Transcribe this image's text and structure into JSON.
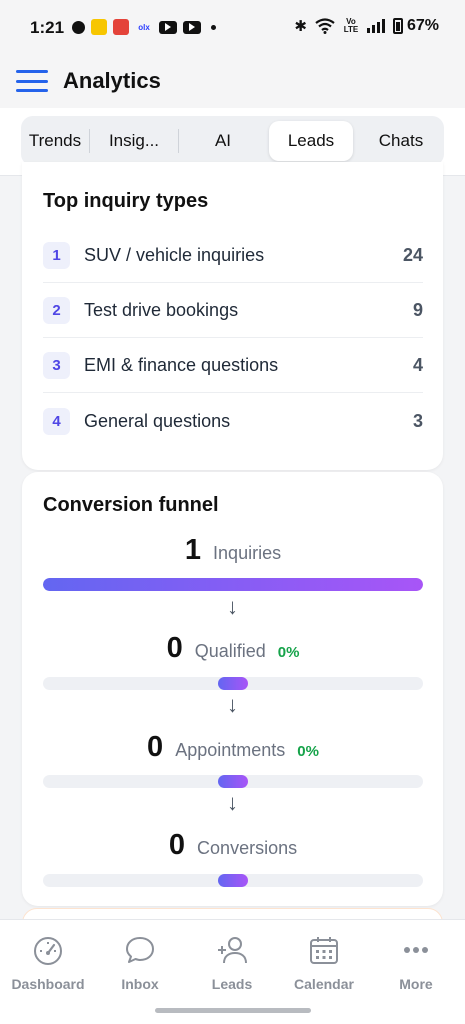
{
  "status_bar": {
    "time": "1:21",
    "battery": "67%",
    "volte": "Vo LTE"
  },
  "header": {
    "title": "Analytics"
  },
  "tabs": [
    {
      "label": "Trends",
      "active": false
    },
    {
      "label": "Insig...",
      "active": false
    },
    {
      "label": "AI",
      "active": false
    },
    {
      "label": "Leads",
      "active": true
    },
    {
      "label": "Chats",
      "active": false
    }
  ],
  "top_inquiry": {
    "title": "Top inquiry types",
    "items": [
      {
        "rank": "1",
        "label": "SUV / vehicle inquiries",
        "count": "24"
      },
      {
        "rank": "2",
        "label": "Test drive bookings",
        "count": "9"
      },
      {
        "rank": "3",
        "label": "EMI & finance questions",
        "count": "4"
      },
      {
        "rank": "4",
        "label": "General questions",
        "count": "3"
      }
    ]
  },
  "funnel": {
    "title": "Conversion funnel",
    "arrow": "↓",
    "steps": [
      {
        "value": "1",
        "label": "Inquiries",
        "pct": "",
        "fill": 1.0
      },
      {
        "value": "0",
        "label": "Qualified",
        "pct": "0%",
        "fill": 0
      },
      {
        "value": "0",
        "label": "Appointments",
        "pct": "0%",
        "fill": 0
      },
      {
        "value": "0",
        "label": "Conversions",
        "pct": "",
        "fill": 0
      }
    ]
  },
  "bottom_nav": [
    {
      "label": "Dashboard",
      "icon": "gauge-icon"
    },
    {
      "label": "Inbox",
      "icon": "chat-bubble-icon"
    },
    {
      "label": "Leads",
      "icon": "add-user-icon"
    },
    {
      "label": "Calendar",
      "icon": "calendar-icon"
    },
    {
      "label": "More",
      "icon": "more-dots-icon"
    }
  ],
  "colors": {
    "accent": "#2563eb",
    "funnel_start": "#6366f1",
    "funnel_end": "#a855f7",
    "pct_green": "#16a34a"
  }
}
